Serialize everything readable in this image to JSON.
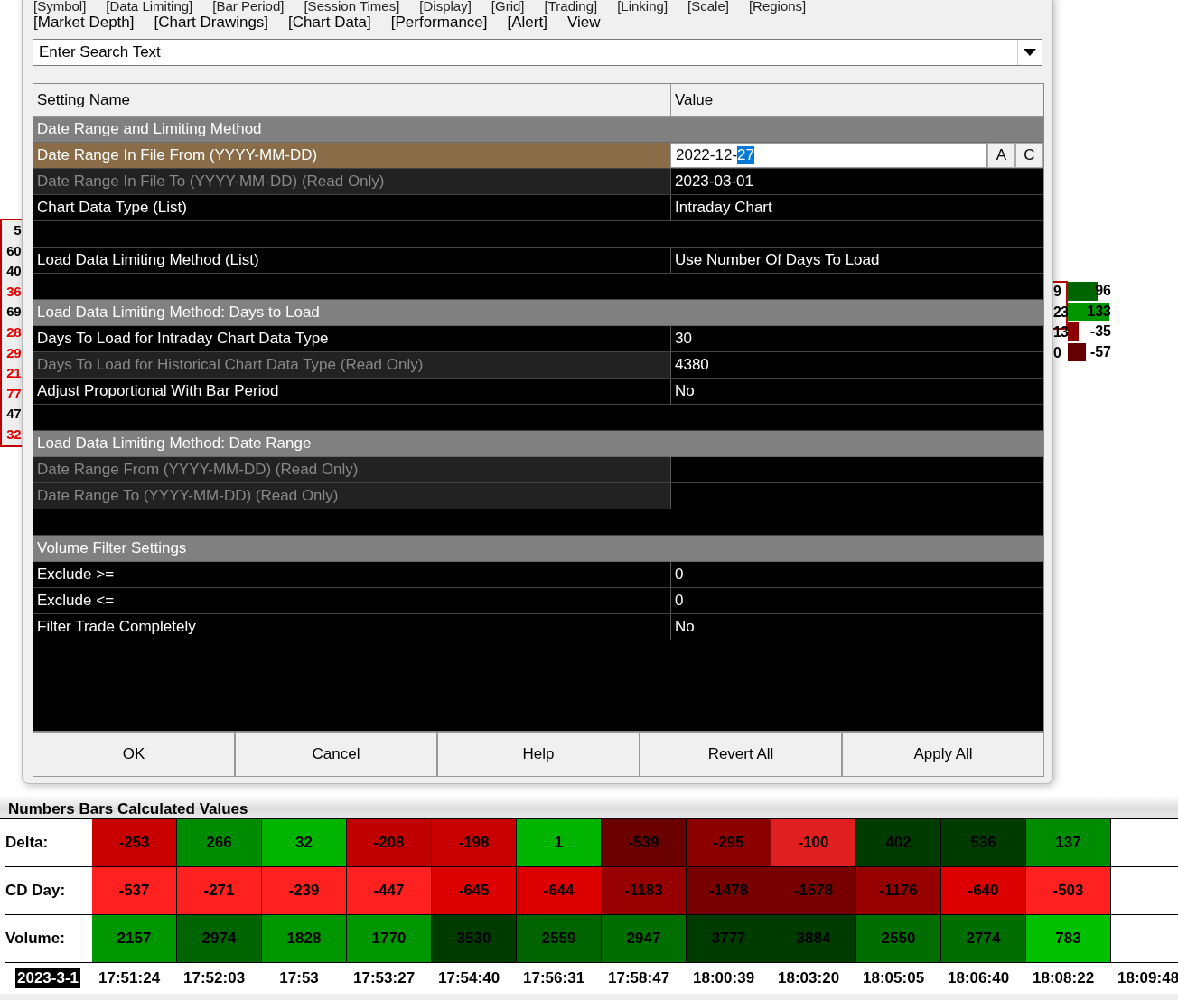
{
  "menu_rows": [
    [
      "[Symbol]",
      "[Data Limiting]",
      "[Bar Period]",
      "[Session Times]",
      "[Display]",
      "[Grid]",
      "[Trading]",
      "[Linking]",
      "[Scale]",
      "[Regions]"
    ],
    [
      "[Market Depth]",
      "[Chart Drawings]",
      "[Chart Data]",
      "[Performance]",
      "[Alert]",
      "View"
    ]
  ],
  "search": {
    "placeholder": "Enter Search Text"
  },
  "settings": {
    "columns": [
      "Setting Name",
      "Value"
    ],
    "rows": [
      {
        "kind": "section",
        "name": "Date Range and Limiting Method"
      },
      {
        "kind": "setting",
        "name": "Date Range In File From (YYYY-MM-DD)",
        "selected": true,
        "read_only": false,
        "editor": {
          "text": "2022-12-",
          "selected_text": "27",
          "buttons": [
            "A",
            "C"
          ]
        }
      },
      {
        "kind": "setting",
        "name": "Date Range In File To (YYYY-MM-DD) (Read Only)",
        "selected": false,
        "read_only": true,
        "value": "2023-03-01"
      },
      {
        "kind": "setting",
        "name": "Chart Data Type (List)",
        "selected": false,
        "read_only": false,
        "value": "Intraday Chart"
      },
      {
        "kind": "blank"
      },
      {
        "kind": "setting",
        "name": "Load Data Limiting Method (List)",
        "selected": false,
        "read_only": false,
        "value": "Use Number Of Days To Load"
      },
      {
        "kind": "blank"
      },
      {
        "kind": "section",
        "name": "Load Data Limiting Method: Days to Load"
      },
      {
        "kind": "setting",
        "name": "Days To Load for Intraday Chart Data Type",
        "selected": false,
        "read_only": false,
        "value": "30"
      },
      {
        "kind": "setting",
        "name": "Days To Load for Historical Chart Data Type (Read Only)",
        "selected": false,
        "read_only": true,
        "value": "4380"
      },
      {
        "kind": "setting",
        "name": "Adjust Proportional With Bar Period",
        "selected": false,
        "read_only": false,
        "value": "No"
      },
      {
        "kind": "blank"
      },
      {
        "kind": "section",
        "name": "Load Data Limiting Method: Date Range"
      },
      {
        "kind": "setting",
        "name": "Date Range From (YYYY-MM-DD) (Read Only)",
        "selected": false,
        "read_only": true
      },
      {
        "kind": "setting",
        "name": "Date Range To (YYYY-MM-DD) (Read Only)",
        "selected": false,
        "read_only": true
      },
      {
        "kind": "blank"
      },
      {
        "kind": "section",
        "name": "Volume Filter Settings"
      },
      {
        "kind": "setting",
        "name": "Exclude >=",
        "selected": false,
        "read_only": false,
        "value": "0"
      },
      {
        "kind": "setting",
        "name": "Exclude <=",
        "selected": false,
        "read_only": false,
        "value": "0"
      },
      {
        "kind": "setting",
        "name": "Filter Trade Completely",
        "selected": false,
        "read_only": false,
        "value": "No"
      }
    ]
  },
  "buttons": [
    "OK",
    "Cancel",
    "Help",
    "Revert All",
    "Apply All"
  ],
  "left_scale": [
    {
      "text": "5",
      "color": "#000000"
    },
    {
      "text": "60",
      "color": "#000000"
    },
    {
      "text": "40",
      "color": "#000000"
    },
    {
      "text": "36",
      "color": "#e00000"
    },
    {
      "text": "69",
      "color": "#000000"
    },
    {
      "text": "28",
      "color": "#e00000"
    },
    {
      "text": "29",
      "color": "#e00000"
    },
    {
      "text": "21",
      "color": "#e00000"
    },
    {
      "text": "77",
      "color": "#e00000"
    },
    {
      "text": "47",
      "color": "#000000"
    },
    {
      "text": "32",
      "color": "#e00000"
    }
  ],
  "right_labels": [
    "9",
    "23",
    "13",
    "0"
  ],
  "right_bars": [
    {
      "value": "96",
      "color": "#006400"
    },
    {
      "value": "133",
      "color": "#009600"
    },
    {
      "value": "-35",
      "color": "#8c0000"
    },
    {
      "value": "-57",
      "color": "#640000"
    }
  ],
  "values_panel": {
    "title": "Numbers Bars Calculated Values",
    "rows": [
      {
        "label": "Delta:",
        "cells": [
          {
            "text": "-253",
            "color": "#c80000"
          },
          {
            "text": "266",
            "color": "#008c00"
          },
          {
            "text": "32",
            "color": "#00b400"
          },
          {
            "text": "-208",
            "color": "#c00000"
          },
          {
            "text": "-198",
            "color": "#c80000"
          },
          {
            "text": "1",
            "color": "#00b400"
          },
          {
            "text": "-539",
            "color": "#6a0000"
          },
          {
            "text": "-295",
            "color": "#8c0000"
          },
          {
            "text": "-100",
            "color": "#e02020"
          },
          {
            "text": "402",
            "color": "#003c00"
          },
          {
            "text": "536",
            "color": "#003c00"
          },
          {
            "text": "137",
            "color": "#008c00"
          }
        ]
      },
      {
        "label": "CD Day:",
        "cells": [
          {
            "text": "-537",
            "color": "#ff2020"
          },
          {
            "text": "-271",
            "color": "#ff2020"
          },
          {
            "text": "-239",
            "color": "#ff2020"
          },
          {
            "text": "-447",
            "color": "#ff2020"
          },
          {
            "text": "-645",
            "color": "#dc0000"
          },
          {
            "text": "-644",
            "color": "#dc0000"
          },
          {
            "text": "-1183",
            "color": "#960000"
          },
          {
            "text": "-1478",
            "color": "#780000"
          },
          {
            "text": "-1578",
            "color": "#780000"
          },
          {
            "text": "-1176",
            "color": "#960000"
          },
          {
            "text": "-640",
            "color": "#dc0000"
          },
          {
            "text": "-503",
            "color": "#ff2020"
          }
        ]
      },
      {
        "label": "Volume:",
        "cells": [
          {
            "text": "2157",
            "color": "#009600"
          },
          {
            "text": "2974",
            "color": "#006400"
          },
          {
            "text": "1828",
            "color": "#009600"
          },
          {
            "text": "1770",
            "color": "#009600"
          },
          {
            "text": "3530",
            "color": "#003c00"
          },
          {
            "text": "2559",
            "color": "#006400"
          },
          {
            "text": "2947",
            "color": "#006e00"
          },
          {
            "text": "3777",
            "color": "#003c00"
          },
          {
            "text": "3884",
            "color": "#003c00"
          },
          {
            "text": "2550",
            "color": "#006e00"
          },
          {
            "text": "2774",
            "color": "#006e00"
          },
          {
            "text": "783",
            "color": "#00c000"
          }
        ]
      }
    ]
  },
  "time_axis": {
    "date": "2023-3-1",
    "times": [
      "17:51:24",
      "17:52:03",
      "17:53",
      "17:53:27",
      "17:54:40",
      "17:56:31",
      "17:58:47",
      "18:00:39",
      "18:03:20",
      "18:05:05",
      "18:06:40",
      "18:08:22",
      "18:09:48"
    ]
  }
}
